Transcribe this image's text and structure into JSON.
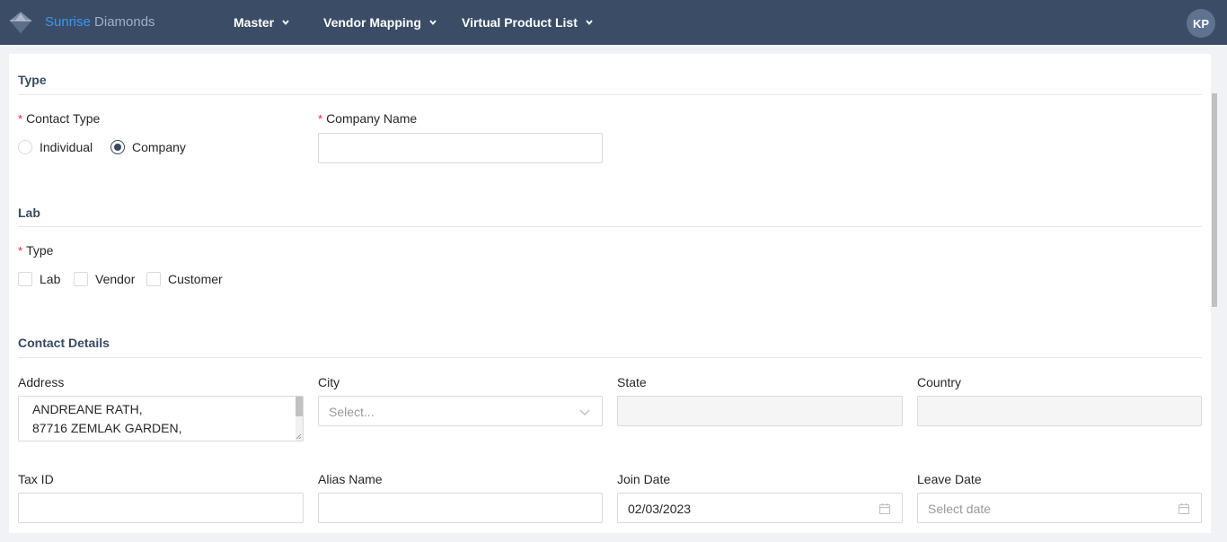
{
  "header": {
    "brand_part1": "Sunrise",
    "brand_part2": "Diamonds",
    "nav": [
      "Master",
      "Vendor Mapping",
      "Virtual Product List"
    ],
    "avatar_initials": "KP"
  },
  "sections": {
    "type": {
      "title": "Type",
      "contact_type_label": "Contact Type",
      "contact_type_options": [
        "Individual",
        "Company"
      ],
      "contact_type_selected": "Company",
      "company_name_label": "Company Name",
      "company_name_value": ""
    },
    "lab": {
      "title": "Lab",
      "type_label": "Type",
      "type_options": [
        "Lab",
        "Vendor",
        "Customer"
      ]
    },
    "contact_details": {
      "title": "Contact Details",
      "address_label": "Address",
      "address_lines": [
        "ANDREANE RATH,",
        "87716 ZEMLAK GARDEN,"
      ],
      "city_label": "City",
      "city_placeholder": "Select...",
      "state_label": "State",
      "country_label": "Country",
      "tax_id_label": "Tax ID",
      "alias_name_label": "Alias Name",
      "join_date_label": "Join Date",
      "join_date_value": "02/03/2023",
      "leave_date_label": "Leave Date",
      "leave_date_placeholder": "Select date"
    }
  },
  "colors": {
    "header_bg": "#3b4d66",
    "brand_accent": "#3b97f0",
    "section_title": "#384a61",
    "required_mark": "#f5222d"
  }
}
